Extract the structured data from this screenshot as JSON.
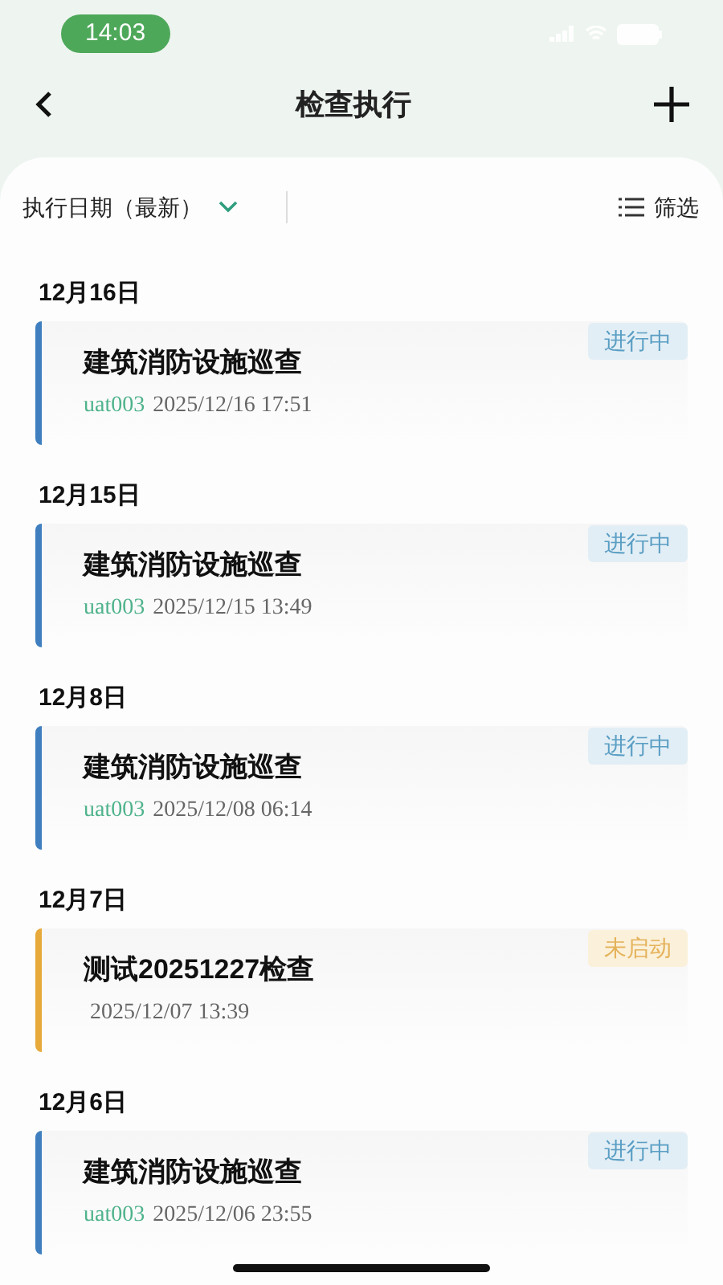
{
  "status_bar": {
    "time": "14:03"
  },
  "header": {
    "title": "检查执行"
  },
  "filter_bar": {
    "sort_label": "执行日期（最新）",
    "filter_label": "筛选"
  },
  "groups": [
    {
      "date": "12月16日",
      "items": [
        {
          "title": "建筑消防设施巡查",
          "user": "uat003",
          "time": "2025/12/16 17:51",
          "status": {
            "kind": "in_progress",
            "label": "进行中"
          }
        }
      ]
    },
    {
      "date": "12月15日",
      "items": [
        {
          "title": "建筑消防设施巡查",
          "user": "uat003",
          "time": "2025/12/15 13:49",
          "status": {
            "kind": "in_progress",
            "label": "进行中"
          }
        }
      ]
    },
    {
      "date": "12月8日",
      "items": [
        {
          "title": "建筑消防设施巡查",
          "user": "uat003",
          "time": "2025/12/08 06:14",
          "status": {
            "kind": "in_progress",
            "label": "进行中"
          }
        }
      ]
    },
    {
      "date": "12月7日",
      "items": [
        {
          "title": "测试20251227检查",
          "time": "2025/12/07 13:39",
          "status": {
            "kind": "not_started",
            "label": "未启动"
          }
        }
      ]
    },
    {
      "date": "12月6日",
      "items": [
        {
          "title": "建筑消防设施巡查",
          "user": "uat003",
          "time": "2025/12/06 23:55",
          "status": {
            "kind": "in_progress",
            "label": "进行中"
          }
        }
      ]
    }
  ]
}
